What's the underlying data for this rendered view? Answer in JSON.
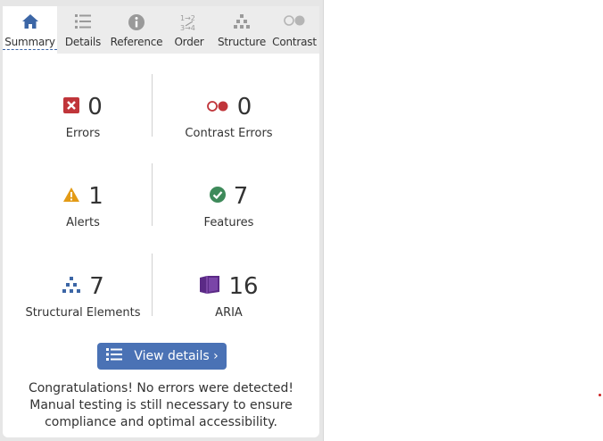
{
  "tabs": [
    {
      "label": "Summary",
      "icon": "home-icon",
      "active": true
    },
    {
      "label": "Details",
      "icon": "list-icon"
    },
    {
      "label": "Reference",
      "icon": "info-icon"
    },
    {
      "label": "Order",
      "icon": "order-icon"
    },
    {
      "label": "Structure",
      "icon": "structure-icon"
    },
    {
      "label": "Contrast",
      "icon": "contrast-icon"
    }
  ],
  "summary": {
    "errors": {
      "count": "0",
      "label": "Errors",
      "icon": "error-icon",
      "color": "#c0353a"
    },
    "contrast_errors": {
      "count": "0",
      "label": "Contrast Errors",
      "icon": "contrast-error-icon",
      "color": "#c0353a"
    },
    "alerts": {
      "count": "1",
      "label": "Alerts",
      "icon": "alert-icon",
      "color": "#e39b16"
    },
    "features": {
      "count": "7",
      "label": "Features",
      "icon": "feature-icon",
      "color": "#3e8a5a"
    },
    "structural": {
      "count": "7",
      "label": "Structural Elements",
      "icon": "structure-icon",
      "color": "#3c66a6"
    },
    "aria": {
      "count": "16",
      "label": "ARIA",
      "icon": "aria-icon",
      "color": "#5b2a86"
    }
  },
  "view_details": {
    "label": "View details ›",
    "icon": "list-icon"
  },
  "message": "Congratulations! No errors were detected! Manual testing is still necessary to ensure compliance and optimal accessibility.",
  "colors": {
    "accent": "#4a72b5",
    "panel_bg": "#e6e6e6"
  }
}
